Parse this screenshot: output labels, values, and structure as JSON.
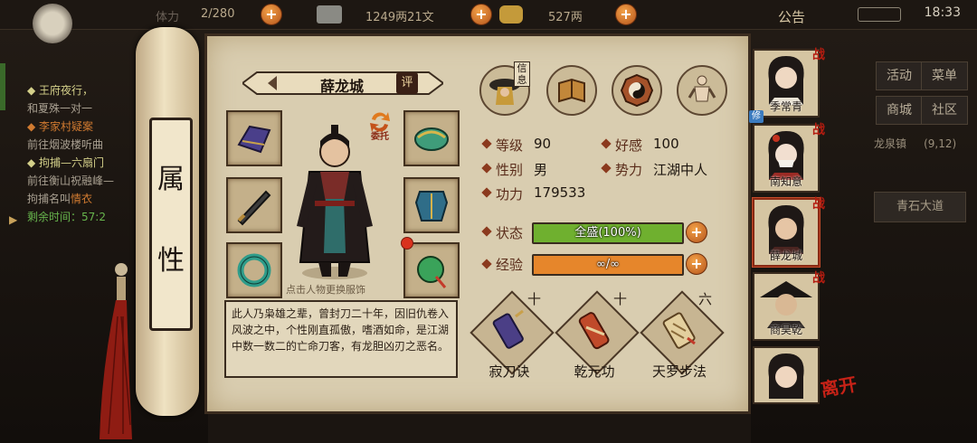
{
  "top_bar": {
    "stamina": "2/280",
    "silver": "1249两21文",
    "gold": "527两",
    "announcement": "公告",
    "time": "18:33"
  },
  "quest_log": [
    {
      "title": "王府夜行，",
      "detail": "和夏殊一对一"
    },
    {
      "title": "李家村疑案",
      "detail": "前往烟波楼听曲"
    },
    {
      "title": "拘捕—六扇门",
      "detail": "前往衡山祝融峰—",
      "detail2_prefix": "拘捕名叫",
      "detail2_highlight": "情衣",
      "remaining_label": "剩余时间：",
      "remaining": "57:2"
    }
  ],
  "right_menu": {
    "buttons": [
      "活动",
      "菜单",
      "商城",
      "社区"
    ],
    "location": "龙泉镇",
    "coords": "(9,12)",
    "road": "青石大道"
  },
  "scroll": {
    "chars": [
      "属",
      "性"
    ]
  },
  "character": {
    "name": "薛龙城",
    "eval_label": "评",
    "entrust_label": "委托",
    "change_hint": "点击人物更换服饰",
    "bio": "此人乃枭雄之辈，曾封刀二十年，因旧仇卷入风波之中，个性刚直孤傲，嗜酒如命，是江湖中数一数二的亡命刀客，有龙胆凶刃之恶名。"
  },
  "tabs": [
    {
      "id": "info",
      "label": "信息",
      "icon": "hat-figure-icon"
    },
    {
      "id": "book",
      "label": "",
      "icon": "book-icon"
    },
    {
      "id": "taiji",
      "label": "",
      "icon": "bagua-icon"
    },
    {
      "id": "meridian",
      "label": "",
      "icon": "body-figure-icon"
    }
  ],
  "stats": {
    "level_label": "等级",
    "level": "90",
    "favor_label": "好感",
    "favor": "100",
    "gender_label": "性别",
    "gender": "男",
    "faction_label": "势力",
    "faction": "江湖中人",
    "power_label": "功力",
    "power": "179533",
    "status_label": "状态",
    "status_text": "全盛(100%)",
    "status_fraction": 1.0,
    "exp_label": "经验",
    "exp_text": "∞/∞",
    "exp_fraction": 1.0,
    "status_color": "#6fb02f",
    "exp_color": "#e6862b"
  },
  "skills": [
    {
      "name": "寂刀诀",
      "level": "十",
      "icon": "scroll-weapon-icon"
    },
    {
      "name": "乾元功",
      "level": "十",
      "icon": "red-scroll-icon"
    },
    {
      "name": "天罗步法",
      "level": "六",
      "icon": "map-scroll-icon"
    }
  ],
  "roster": [
    {
      "name": "季常青",
      "badge": "战",
      "tag": "修",
      "selected": false
    },
    {
      "name": "南知意",
      "badge": "战",
      "tag": "",
      "selected": false
    },
    {
      "name": "薛龙城",
      "badge": "战",
      "tag": "",
      "selected": true
    },
    {
      "name": "商昊乾",
      "badge": "战",
      "tag": "",
      "selected": false
    },
    {
      "name": "",
      "badge": "",
      "tag": "",
      "selected": false
    }
  ],
  "leave_label": "离开"
}
